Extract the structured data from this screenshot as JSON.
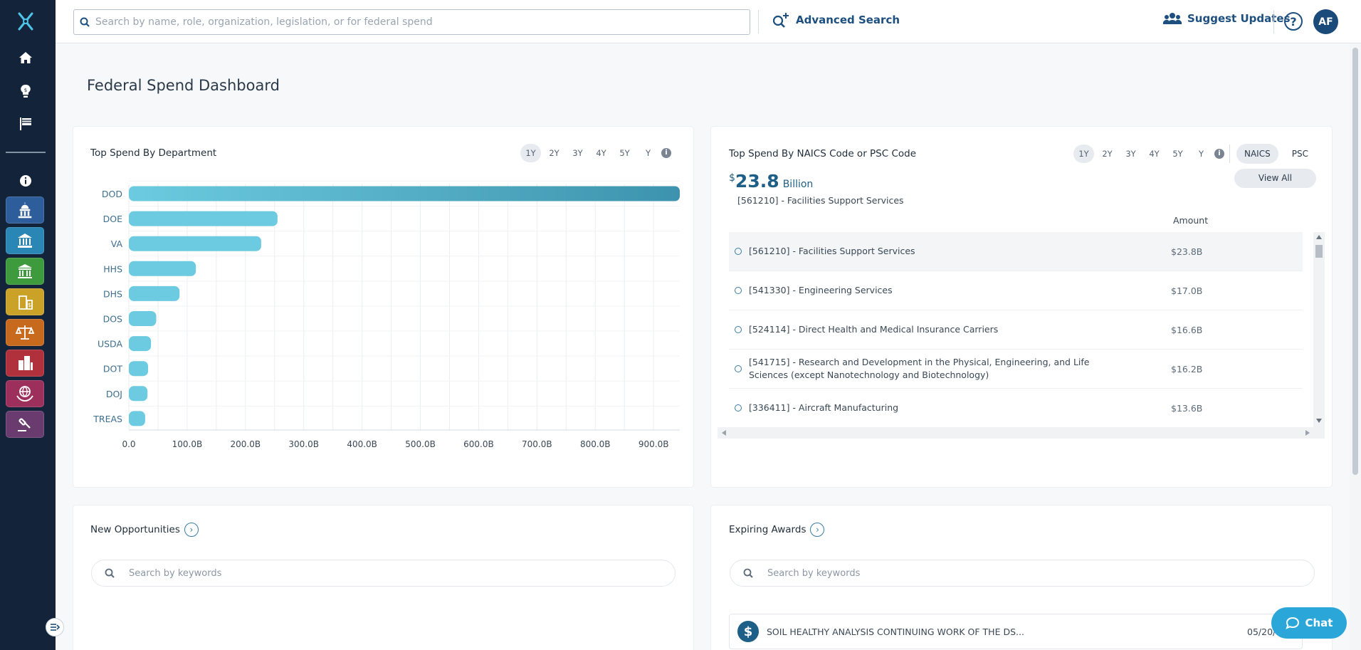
{
  "topbar": {
    "search_placeholder": "Search by name, role, organization, legislation, or for federal spend",
    "advanced_search": "Advanced Search",
    "suggest_updates": "Suggest Updates",
    "help": "?",
    "avatar": "AF"
  },
  "sidebar": {
    "tiles": [
      {
        "name": "capitol-icon",
        "color": "#2e5d9c"
      },
      {
        "name": "institution-icon",
        "color": "#2a86b4"
      },
      {
        "name": "government-building-icon",
        "color": "#3d9a3d"
      },
      {
        "name": "money-building-icon",
        "color": "#c9a227"
      },
      {
        "name": "justice-scale-icon",
        "color": "#c86a1e"
      },
      {
        "name": "city-building-icon",
        "color": "#b0303b"
      },
      {
        "name": "globe-hands-icon",
        "color": "#9c2f5b"
      },
      {
        "name": "gavel-icon",
        "color": "#6a3b6e"
      }
    ]
  },
  "page": {
    "title": "Federal Spend Dashboard"
  },
  "dept_card": {
    "title": "Top Spend By Department",
    "periods": [
      "1Y",
      "2Y",
      "3Y",
      "4Y",
      "5Y",
      "Y"
    ],
    "active_period": "1Y"
  },
  "chart_data": {
    "type": "bar",
    "orientation": "horizontal",
    "title": "Top Spend By Department",
    "categories": [
      "DOD",
      "DOE",
      "VA",
      "HHS",
      "DHS",
      "DOS",
      "USDA",
      "DOT",
      "DOJ",
      "TREAS"
    ],
    "values": [
      945,
      255,
      227,
      115,
      87,
      47,
      38,
      33,
      32,
      28
    ],
    "unit": "B",
    "xlim": [
      0,
      945
    ],
    "xticks": [
      "0.0",
      "100.0B",
      "200.0B",
      "300.0B",
      "400.0B",
      "500.0B",
      "600.0B",
      "700.0B",
      "800.0B",
      "900.0B"
    ],
    "xtick_values": [
      0,
      100,
      200,
      300,
      400,
      500,
      600,
      700,
      800,
      900
    ],
    "grid": true,
    "colors": {
      "bar": "#6ccbe0",
      "bar_highlight": "#3d93ad"
    }
  },
  "naics_card": {
    "title": "Top Spend By NAICS Code or PSC Code",
    "periods": [
      "1Y",
      "2Y",
      "3Y",
      "4Y",
      "5Y",
      "Y"
    ],
    "active_period": "1Y",
    "toggle": [
      "NAICS",
      "PSC"
    ],
    "active_toggle": "NAICS",
    "view_all": "View All",
    "currency": "$",
    "amount": "23.8",
    "amount_unit": "Billion",
    "selected_code": "[561210] - Facilities Support Services",
    "amount_header": "Amount",
    "rows": [
      {
        "label": "[561210] - Facilities Support Services",
        "amount": "$23.8B"
      },
      {
        "label": "[541330] - Engineering Services",
        "amount": "$17.0B"
      },
      {
        "label": "[524114] - Direct Health and Medical Insurance Carriers",
        "amount": "$16.6B"
      },
      {
        "label": "[541715] - Research and Development in the Physical, Engineering, and Life Sciences (except Nanotechnology and Biotechnology)",
        "amount": "$16.2B"
      },
      {
        "label": "[336411] - Aircraft Manufacturing",
        "amount": "$13.6B"
      }
    ]
  },
  "opportunities": {
    "title": "New Opportunities",
    "search_placeholder": "Search by keywords"
  },
  "expiring": {
    "title": "Expiring Awards",
    "search_placeholder": "Search by keywords",
    "item_title": "SOIL HEALTHY ANALYSIS CONTINUING WORK OF THE DS...",
    "item_date": "05/20/"
  },
  "chat": {
    "label": "Chat"
  }
}
